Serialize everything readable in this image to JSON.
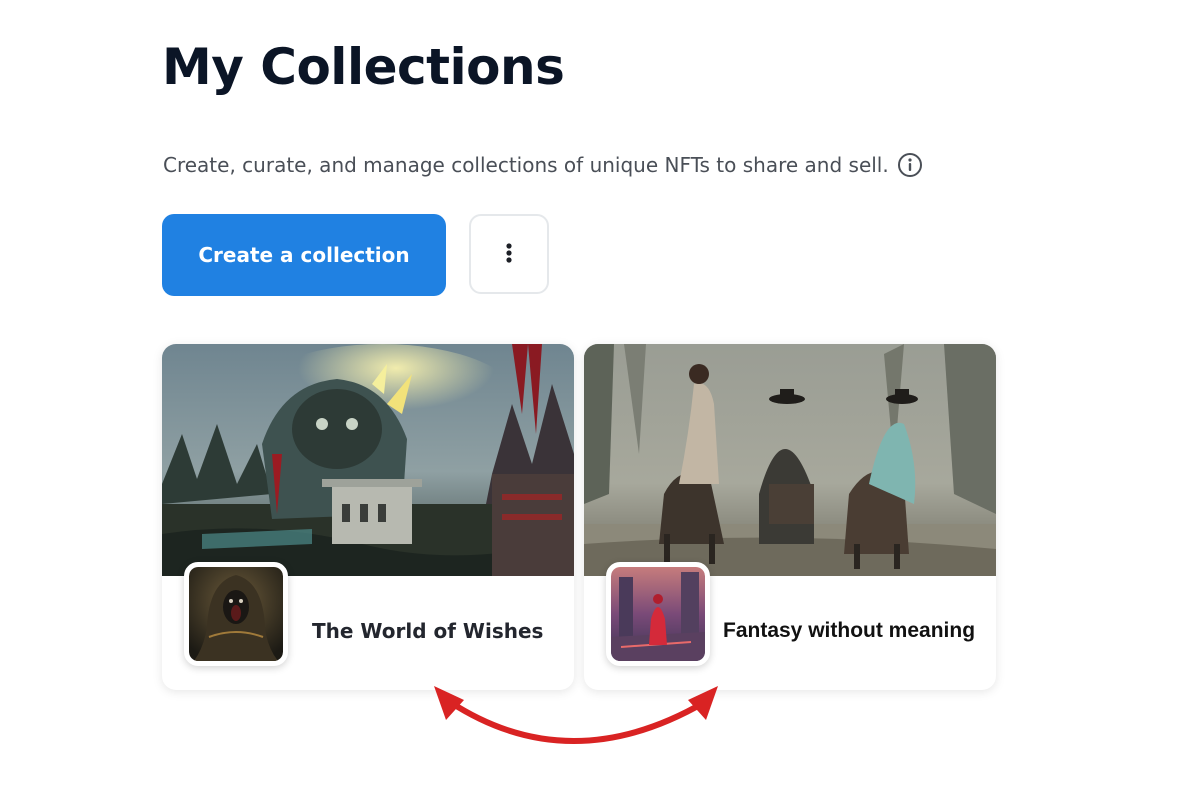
{
  "header": {
    "title": "My Collections",
    "subtitle": "Create, curate, and manage collections of unique NFTs to share and sell."
  },
  "actions": {
    "create_label": "Create a collection",
    "more_icon": "more-vertical-icon"
  },
  "collections": [
    {
      "name": "The World of Wishes",
      "banner": "dark fantasy statue landscape painting",
      "avatar": "hooded screaming figure painting"
    },
    {
      "name": "Fantasy without meaning",
      "banner": "riders on horses in misty street painting",
      "avatar": "red figure in neon city painting"
    }
  ],
  "annotation": {
    "icon": "double-headed-arrow-icon",
    "color": "#d92323"
  },
  "colors": {
    "accent": "#2081e2",
    "title": "#0b1526",
    "text": "#4a4f57"
  }
}
